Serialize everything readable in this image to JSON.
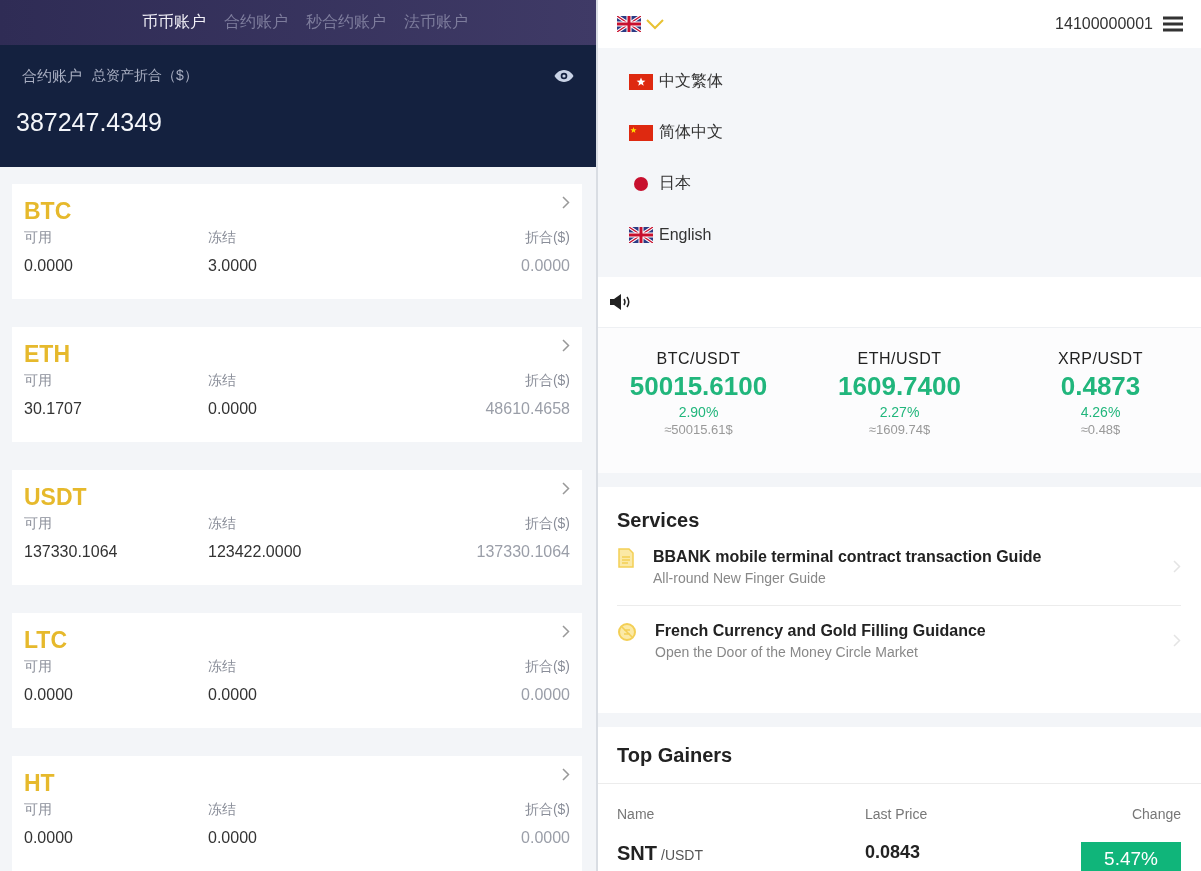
{
  "account_tabs": [
    {
      "label": "币币账户",
      "selected": true
    },
    {
      "label": "合约账户",
      "selected": false
    },
    {
      "label": "秒合约账户",
      "selected": false
    },
    {
      "label": "法币账户",
      "selected": false
    }
  ],
  "summary": {
    "account": "合约账户",
    "total_label": "总资产折合（$）",
    "total": "387247.4349"
  },
  "assets": [
    {
      "coin": "BTC",
      "available_label": "可用",
      "frozen_label": "冻结",
      "value_label": "折合($)",
      "available": "0.0000",
      "frozen": "3.0000",
      "value": "0.0000"
    },
    {
      "coin": "ETH",
      "available_label": "可用",
      "frozen_label": "冻结",
      "value_label": "折合($)",
      "available": "30.1707",
      "frozen": "0.0000",
      "value": "48610.4658"
    },
    {
      "coin": "USDT",
      "available_label": "可用",
      "frozen_label": "冻结",
      "value_label": "折合($)",
      "available": "137330.1064",
      "frozen": "123422.0000",
      "value": "137330.1064"
    },
    {
      "coin": "LTC",
      "available_label": "可用",
      "frozen_label": "冻结",
      "value_label": "折合($)",
      "available": "0.0000",
      "frozen": "0.0000",
      "value": "0.0000"
    },
    {
      "coin": "HT",
      "available_label": "可用",
      "frozen_label": "冻结",
      "value_label": "折合($)",
      "available": "0.0000",
      "frozen": "0.0000",
      "value": "0.0000"
    }
  ],
  "top_bar": {
    "flag": {
      "kind": "uk"
    },
    "account": "14100000001"
  },
  "languages": [
    {
      "kind": "hk",
      "label": "中文繁体"
    },
    {
      "kind": "cn",
      "label": "简体中文"
    },
    {
      "kind": "jp",
      "label": "日本"
    },
    {
      "kind": "uk",
      "label": "English"
    }
  ],
  "tickers": [
    {
      "pair": "BTC/USDT",
      "price": "50015.6100",
      "change": "2.90%",
      "approx": "≈50015.61$"
    },
    {
      "pair": "ETH/USDT",
      "price": "1609.7400",
      "change": "2.27%",
      "approx": "≈1609.74$"
    },
    {
      "pair": "XRP/USDT",
      "price": "0.4873",
      "change": "4.26%",
      "approx": "≈0.48$"
    }
  ],
  "services": {
    "title": "Services",
    "items": [
      {
        "kind": "document",
        "title": "BBANK mobile terminal contract transaction Guide",
        "subtitle": "All-round New Finger Guide"
      },
      {
        "kind": "coin",
        "title": "French Currency and Gold Filling Guidance",
        "subtitle": "Open the Door of the Money Circle Market"
      }
    ]
  },
  "top_gainers": {
    "title": "Top Gainers",
    "columns": [
      "Name",
      "Last Price",
      "Change"
    ],
    "rows": [
      {
        "base": "SNT",
        "quote": "/USDT",
        "price": "0.0843",
        "change": "5.47%"
      }
    ]
  }
}
